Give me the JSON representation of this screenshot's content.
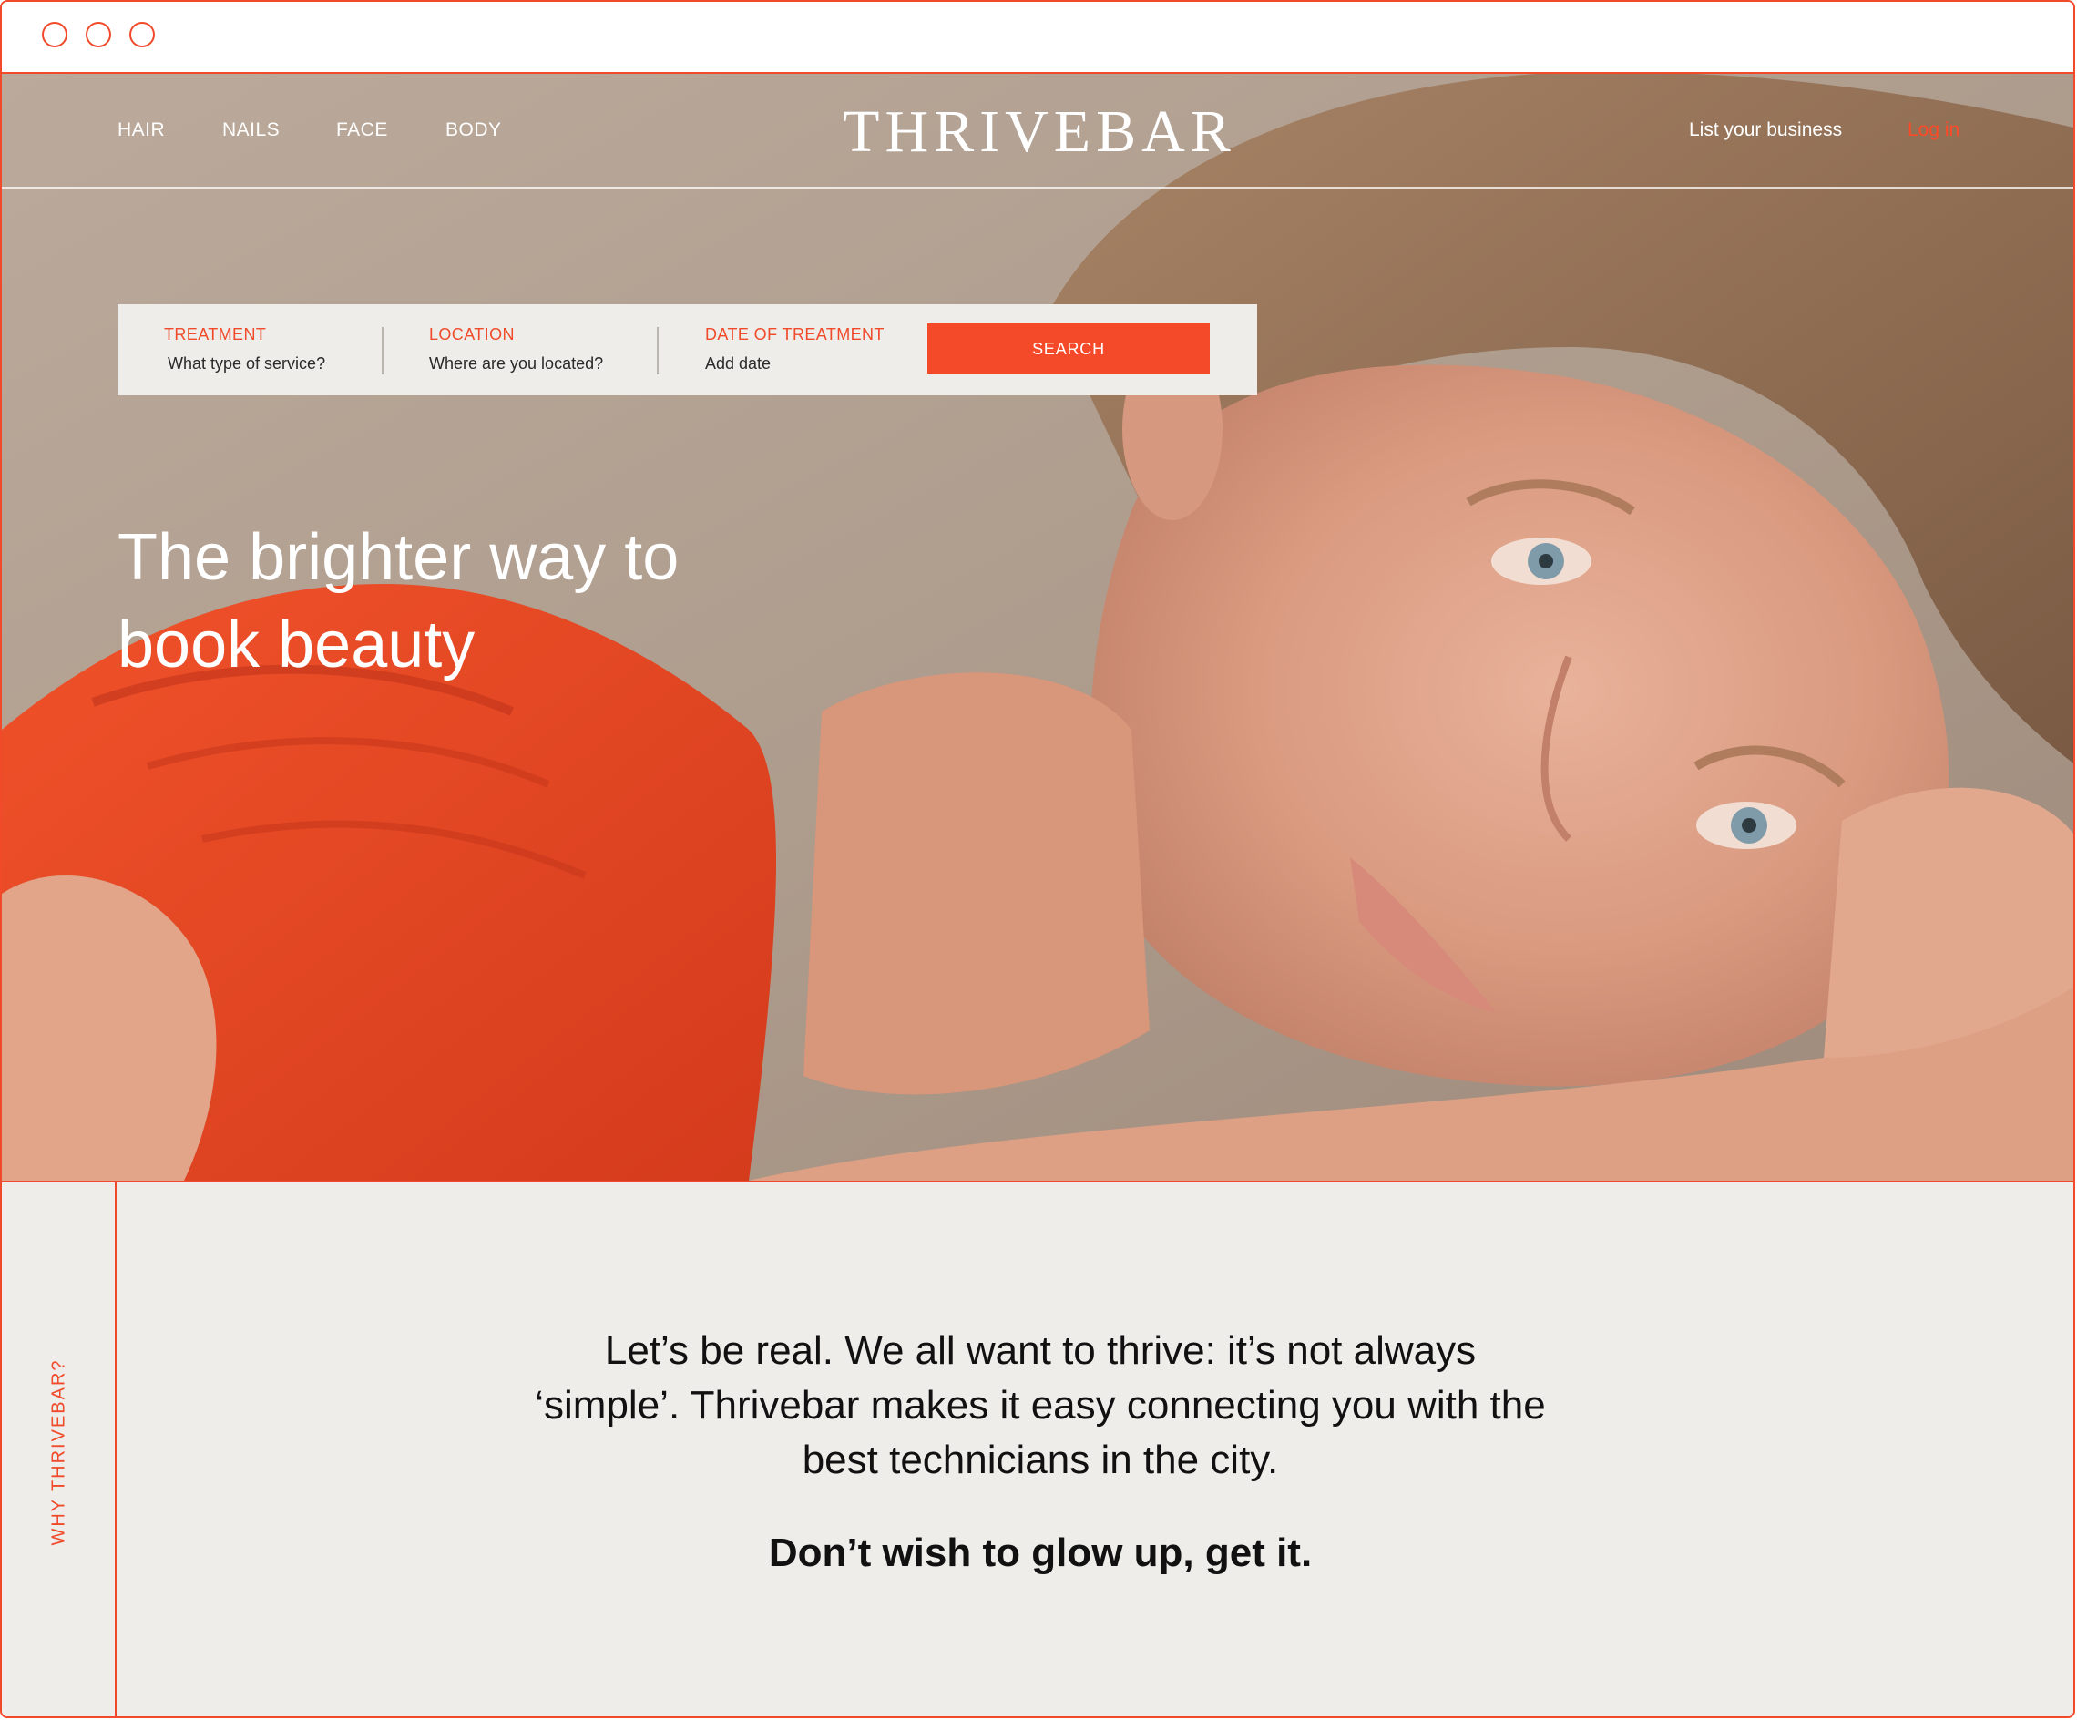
{
  "nav": {
    "links": [
      "HAIR",
      "NAILS",
      "FACE",
      "BODY"
    ],
    "logo": "THRIVEBAR",
    "list_business": "List your business",
    "login": "Log in"
  },
  "search": {
    "treatment_label": "TREATMENT",
    "treatment_value": "What type of service?",
    "location_label": "LOCATION",
    "location_value": "Where are you located?",
    "date_label": "DATE OF TREATMENT",
    "date_value": "Add date",
    "button": "SEARCH"
  },
  "hero": {
    "headline_line1": "The brighter way to",
    "headline_line2": "book beauty"
  },
  "why": {
    "label": "WHY THRIVEBAR?",
    "body_line1": "Let’s be real. We all want to thrive: it’s not always",
    "body_line2": "‘simple’. Thrivebar makes it easy connecting you with the",
    "body_line3": "best technicians in the city.",
    "tagline": "Don’t wish to glow up, get it."
  },
  "colors": {
    "accent": "#f04a2a",
    "button": "#f54a29",
    "panel": "#eeedea",
    "hero_bg": "#b6a496",
    "shirt": "#e8421f"
  }
}
